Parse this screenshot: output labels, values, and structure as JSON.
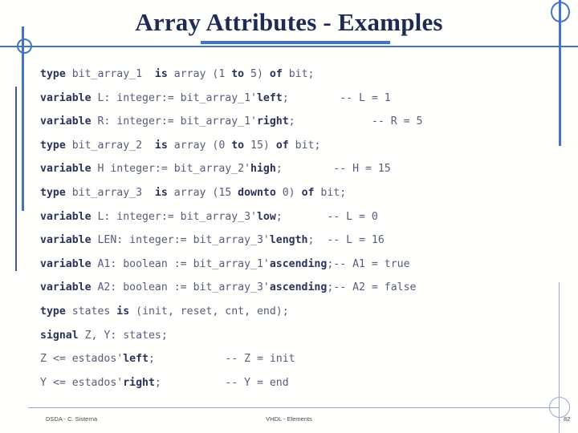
{
  "slide": {
    "title": "Array Attributes - Examples",
    "accent_color": "#4472c4",
    "title_color": "#1f2a52",
    "code_color": "#565d7a",
    "keyword_color": "#2b3257"
  },
  "code": {
    "lines": [
      {
        "id": "line-1",
        "segments": [
          {
            "t": "kw",
            "s": "type"
          },
          {
            "t": "code",
            "s": " bit_array_1  "
          },
          {
            "t": "kw",
            "s": "is"
          },
          {
            "t": "code",
            "s": " array (1 "
          },
          {
            "t": "kw",
            "s": "to"
          },
          {
            "t": "code",
            "s": " 5) "
          },
          {
            "t": "kw",
            "s": "of"
          },
          {
            "t": "code",
            "s": " bit;"
          }
        ]
      },
      {
        "id": "line-2",
        "segments": [
          {
            "t": "kw",
            "s": "variable"
          },
          {
            "t": "code",
            "s": " L: integer:= bit_array_1'"
          },
          {
            "t": "kw",
            "s": "left"
          },
          {
            "t": "code",
            "s": ";        "
          },
          {
            "t": "cmt",
            "s": "-- L = 1"
          }
        ]
      },
      {
        "id": "line-3",
        "segments": [
          {
            "t": "kw",
            "s": "variable"
          },
          {
            "t": "code",
            "s": " R: integer:= bit_array_1'"
          },
          {
            "t": "kw",
            "s": "right"
          },
          {
            "t": "code",
            "s": ";            "
          },
          {
            "t": "cmt",
            "s": "-- R = 5"
          }
        ]
      },
      {
        "id": "line-4",
        "segments": [
          {
            "t": "kw",
            "s": "type"
          },
          {
            "t": "code",
            "s": " bit_array_2  "
          },
          {
            "t": "kw",
            "s": "is"
          },
          {
            "t": "code",
            "s": " array (0 "
          },
          {
            "t": "kw",
            "s": "to"
          },
          {
            "t": "code",
            "s": " 15) "
          },
          {
            "t": "kw",
            "s": "of"
          },
          {
            "t": "code",
            "s": " bit;"
          }
        ]
      },
      {
        "id": "line-5",
        "segments": [
          {
            "t": "kw",
            "s": "variable"
          },
          {
            "t": "code",
            "s": " H integer:= bit_array_2'"
          },
          {
            "t": "kw",
            "s": "high"
          },
          {
            "t": "code",
            "s": ";        "
          },
          {
            "t": "cmt",
            "s": "-- H = 15"
          }
        ]
      },
      {
        "id": "line-6",
        "segments": [
          {
            "t": "kw",
            "s": "type"
          },
          {
            "t": "code",
            "s": " bit_array_3  "
          },
          {
            "t": "kw",
            "s": "is"
          },
          {
            "t": "code",
            "s": " array (15 "
          },
          {
            "t": "kw",
            "s": "downto"
          },
          {
            "t": "code",
            "s": " 0) "
          },
          {
            "t": "kw",
            "s": "of"
          },
          {
            "t": "code",
            "s": " bit;"
          }
        ]
      },
      {
        "id": "line-7",
        "segments": [
          {
            "t": "kw",
            "s": "variable"
          },
          {
            "t": "code",
            "s": " L: integer:= bit_array_3'"
          },
          {
            "t": "kw",
            "s": "low"
          },
          {
            "t": "code",
            "s": ";       "
          },
          {
            "t": "cmt",
            "s": "-- L = 0"
          }
        ]
      },
      {
        "id": "line-8",
        "segments": [
          {
            "t": "kw",
            "s": "variable"
          },
          {
            "t": "code",
            "s": " LEN: integer:= bit_array_3'"
          },
          {
            "t": "kw",
            "s": "length"
          },
          {
            "t": "code",
            "s": ";  "
          },
          {
            "t": "cmt",
            "s": "-- L = 16"
          }
        ]
      },
      {
        "id": "line-9",
        "segments": [
          {
            "t": "kw",
            "s": "variable"
          },
          {
            "t": "code",
            "s": " A1: boolean := bit_array_1'"
          },
          {
            "t": "kw",
            "s": "ascending"
          },
          {
            "t": "code",
            "s": ";"
          },
          {
            "t": "cmt",
            "s": "-- A1 = true"
          }
        ]
      },
      {
        "id": "line-10",
        "segments": [
          {
            "t": "kw",
            "s": "variable"
          },
          {
            "t": "code",
            "s": " A2: boolean := bit_array_3'"
          },
          {
            "t": "kw",
            "s": "ascending"
          },
          {
            "t": "code",
            "s": ";"
          },
          {
            "t": "cmt",
            "s": "-- A2 = false"
          }
        ]
      },
      {
        "id": "line-11",
        "segments": [
          {
            "t": "kw",
            "s": "type"
          },
          {
            "t": "code",
            "s": " states "
          },
          {
            "t": "kw",
            "s": "is"
          },
          {
            "t": "code",
            "s": " (init, reset, cnt, end);"
          }
        ]
      },
      {
        "id": "line-12",
        "segments": [
          {
            "t": "kw",
            "s": "signal"
          },
          {
            "t": "code",
            "s": " Z, Y: states;"
          }
        ]
      },
      {
        "id": "line-13",
        "segments": [
          {
            "t": "code",
            "s": "Z <= estados'"
          },
          {
            "t": "kw",
            "s": "left"
          },
          {
            "t": "code",
            "s": ";           "
          },
          {
            "t": "cmt",
            "s": "-- Z = init"
          }
        ]
      },
      {
        "id": "line-14",
        "segments": [
          {
            "t": "code",
            "s": "Y <= estados'"
          },
          {
            "t": "kw",
            "s": "right"
          },
          {
            "t": "code",
            "s": ";          "
          },
          {
            "t": "cmt",
            "s": "-- Y = end"
          }
        ]
      }
    ]
  },
  "footer": {
    "left": "DSDA - C. Sisterna",
    "center": "VHDL - Elements",
    "page": "82"
  }
}
